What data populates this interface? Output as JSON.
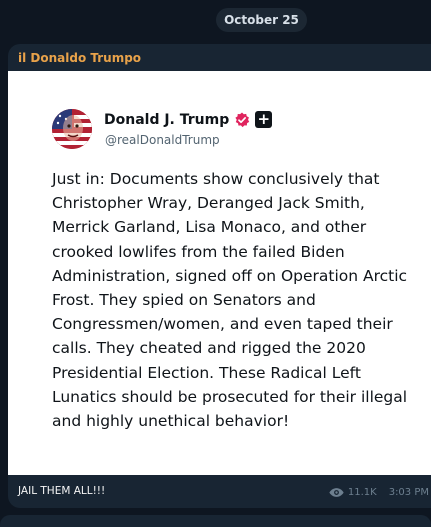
{
  "date_separator": "October 25",
  "message": {
    "sender": "il Donaldo Trumpo",
    "post": {
      "author_name": "Donald J. Trump",
      "handle": "@realDonaldTrump",
      "badge_plus": "+",
      "body": "Just in: Documents show conclusively that Christopher Wray, Deranged Jack Smith, Merrick Garland, Lisa Monaco, and other crooked lowlifes from the failed Biden Administration, signed off on Operation Arctic Frost. They spied on Senators and Congressmen/women, and even taped their calls. They cheated and rigged the 2020 Presidential Election. These Radical Left Lunatics should be prosecuted for their illegal and highly unethical behavior!"
    },
    "caption": "JAIL THEM ALL!!!",
    "views": "11.1K",
    "time": "3:03 PM"
  },
  "colors": {
    "background": "#0e1621",
    "bubble": "#182533",
    "sender_name": "#e8a24a",
    "verified_badge": "#e0245e",
    "meta_text": "#6d7f8f"
  },
  "icons": {
    "verified": "verified-badge-icon",
    "views": "eye-icon"
  }
}
